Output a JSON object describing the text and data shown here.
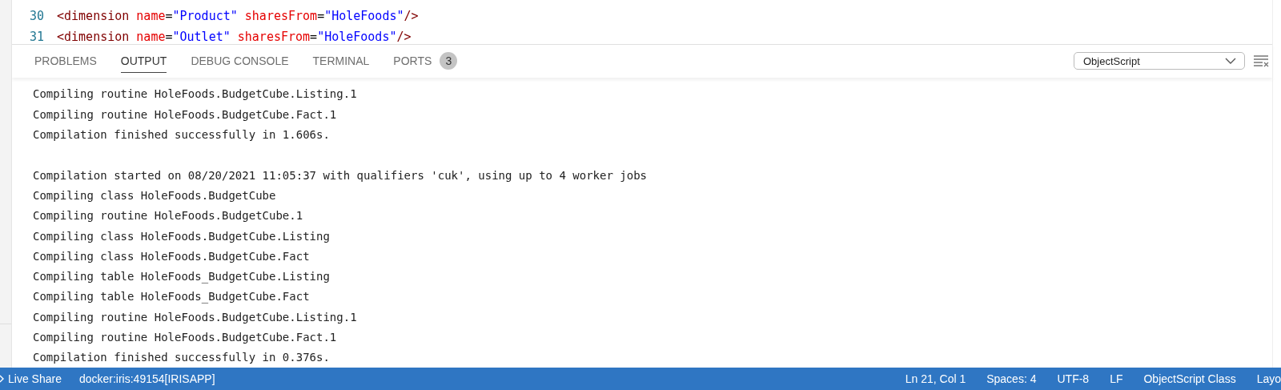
{
  "editor": {
    "lines": [
      {
        "number": "30",
        "tokens": [
          {
            "kind": "tag",
            "text": "<dimension"
          },
          {
            "kind": "attr",
            "text": " name"
          },
          {
            "kind": "eq",
            "text": "="
          },
          {
            "kind": "str",
            "text": "\"Product\""
          },
          {
            "kind": "attr",
            "text": " sharesFrom"
          },
          {
            "kind": "eq",
            "text": "="
          },
          {
            "kind": "str",
            "text": "\"HoleFoods\""
          },
          {
            "kind": "tag",
            "text": "/>"
          }
        ]
      },
      {
        "number": "31",
        "tokens": [
          {
            "kind": "tag",
            "text": "<dimension"
          },
          {
            "kind": "attr",
            "text": " name"
          },
          {
            "kind": "eq",
            "text": "="
          },
          {
            "kind": "str",
            "text": "\"Outlet\""
          },
          {
            "kind": "attr",
            "text": " sharesFrom"
          },
          {
            "kind": "eq",
            "text": "="
          },
          {
            "kind": "str",
            "text": "\"HoleFoods\""
          },
          {
            "kind": "tag",
            "text": "/>"
          }
        ]
      }
    ]
  },
  "panel": {
    "tabs": [
      {
        "label": "PROBLEMS",
        "selected": false
      },
      {
        "label": "OUTPUT",
        "selected": true
      },
      {
        "label": "DEBUG CONSOLE",
        "selected": false
      },
      {
        "label": "TERMINAL",
        "selected": false
      },
      {
        "label": "PORTS",
        "selected": false,
        "badge": "3"
      }
    ],
    "channel_select": {
      "value": "ObjectScript"
    },
    "output_blocks": [
      [
        "Compiling routine HoleFoods.BudgetCube.Listing.1",
        "Compiling routine HoleFoods.BudgetCube.Fact.1",
        "Compilation finished successfully in 1.606s."
      ],
      [
        "Compilation started on 08/20/2021 11:05:37 with qualifiers 'cuk', using up to 4 worker jobs",
        "Compiling class HoleFoods.BudgetCube",
        "Compiling routine HoleFoods.BudgetCube.1",
        "Compiling class HoleFoods.BudgetCube.Listing",
        "Compiling class HoleFoods.BudgetCube.Fact",
        "Compiling table HoleFoods_BudgetCube.Listing",
        "Compiling table HoleFoods_BudgetCube.Fact",
        "Compiling routine HoleFoods.BudgetCube.Listing.1",
        "Compiling routine HoleFoods.BudgetCube.Fact.1",
        "Compilation finished successfully in 0.376s."
      ]
    ]
  },
  "status_bar": {
    "left": [
      "Live Share",
      "docker:iris:49154[IRISAPP]"
    ],
    "right": [
      "Ln 21, Col 1",
      "Spaces: 4",
      "UTF-8",
      "LF",
      "ObjectScript Class",
      "Layo"
    ]
  }
}
